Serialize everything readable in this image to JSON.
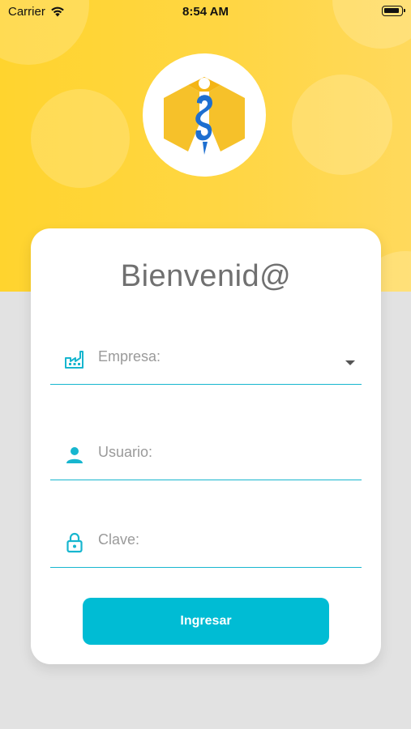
{
  "status_bar": {
    "carrier": "Carrier",
    "time": "8:54 AM"
  },
  "brand": {
    "logo_icon": "isotype-cube-icon"
  },
  "login": {
    "title": "Bienvenid@",
    "empresa_label": "Empresa:",
    "usuario_label": "Usuario:",
    "clave_label": "Clave:",
    "submit_label": "Ingresar"
  },
  "colors": {
    "hero": "#ffd43b",
    "accent": "#00bcd4",
    "background": "#e2e2e2",
    "logo_blue": "#1e6fd0"
  },
  "icons": {
    "empresa": "factory-icon",
    "usuario": "person-icon",
    "clave": "lock-icon",
    "dropdown": "chevron-down-icon"
  }
}
